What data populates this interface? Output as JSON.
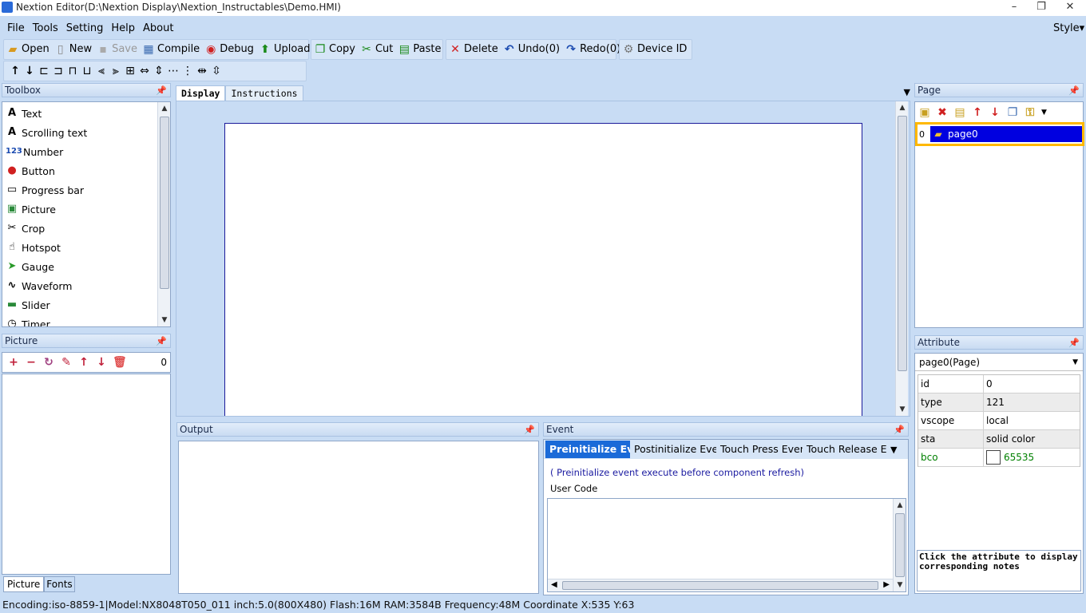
{
  "window": {
    "title": "Nextion Editor(D:\\Nextion Display\\Nextion_Instructables\\Demo.HMI)",
    "min": "–",
    "max": "❐",
    "close": "✕"
  },
  "menu": {
    "items": [
      "File",
      "Tools",
      "Setting",
      "Help",
      "About"
    ],
    "style": "Style▾"
  },
  "toolbar": {
    "open": "Open",
    "new": "New",
    "save": "Save",
    "compile": "Compile",
    "debug": "Debug",
    "upload": "Upload",
    "copy": "Copy",
    "cut": "Cut",
    "paste": "Paste",
    "delete": "Delete",
    "undo": "Undo(0)",
    "redo": "Redo(0)",
    "device_id": "Device  ID"
  },
  "toolbox": {
    "title": "Toolbox",
    "items": [
      {
        "label": "Text",
        "icon": "text-icon",
        "glyph": "A"
      },
      {
        "label": "Scrolling text",
        "icon": "scrolling-text-icon",
        "glyph": "A"
      },
      {
        "label": "Number",
        "icon": "number-icon",
        "glyph": "123"
      },
      {
        "label": "Button",
        "icon": "button-icon",
        "glyph": "●"
      },
      {
        "label": "Progress bar",
        "icon": "progress-bar-icon",
        "glyph": "▭"
      },
      {
        "label": "Picture",
        "icon": "picture-icon",
        "glyph": "▣"
      },
      {
        "label": "Crop",
        "icon": "crop-icon",
        "glyph": "✂"
      },
      {
        "label": "Hotspot",
        "icon": "hotspot-icon",
        "glyph": "☝"
      },
      {
        "label": "Gauge",
        "icon": "gauge-icon",
        "glyph": "➤"
      },
      {
        "label": "Waveform",
        "icon": "waveform-icon",
        "glyph": "∿"
      },
      {
        "label": "Slider",
        "icon": "slider-icon",
        "glyph": "▬"
      },
      {
        "label": "Timer",
        "icon": "timer-icon",
        "glyph": "◷"
      }
    ]
  },
  "picture_panel": {
    "title": "Picture",
    "count": "0",
    "tabs": [
      "Picture",
      "Fonts"
    ]
  },
  "editor": {
    "tabs": [
      "Display",
      "Instructions"
    ]
  },
  "output": {
    "title": "Output"
  },
  "event": {
    "title": "Event",
    "tabs": [
      "Preinitialize Eve...",
      "Postinitialize Eve...",
      "Touch Press Even...",
      "Touch Release Ev..."
    ],
    "note": "( Preinitialize event execute before component refresh)",
    "user_code_label": "User Code"
  },
  "page_panel": {
    "title": "Page",
    "pages": [
      {
        "index": "0",
        "name": "page0"
      }
    ]
  },
  "attribute": {
    "title": "Attribute",
    "selected": "page0(Page)",
    "rows": [
      {
        "key": "id",
        "value": "0"
      },
      {
        "key": "type",
        "value": "121"
      },
      {
        "key": "vscope",
        "value": "local"
      },
      {
        "key": "sta",
        "value": "solid color"
      },
      {
        "key": "bco",
        "value": "65535"
      }
    ],
    "notes": "Click the attribute to display corresponding notes"
  },
  "status": {
    "text": "Encoding:iso-8859-1|Model:NX8048T050_011  inch:5.0(800X480) Flash:16M RAM:3584B Frequency:48M    Coordinate X:535  Y:63"
  },
  "colors": {
    "accent": "#0000e0",
    "highlight": "#ffb800",
    "bco_text": "#008000"
  }
}
